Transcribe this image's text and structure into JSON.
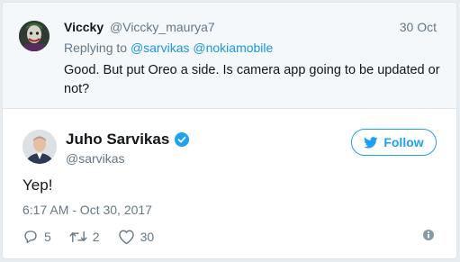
{
  "parent_tweet": {
    "name": "Viccky",
    "handle": "@Viccky_maurya7",
    "time": "30 Oct",
    "replying_prefix": "Replying to",
    "mentions": [
      "@sarvikas",
      "@nokiamobile"
    ],
    "text": "Good. But put Oreo a side. Is camera app going to be updated or not?"
  },
  "main_tweet": {
    "name": "Juho Sarvikas",
    "handle": "@sarvikas",
    "follow_label": "Follow",
    "text": "Yep!",
    "timestamp": "6:17 AM - Oct 30, 2017",
    "reply_count": "5",
    "retweet_count": "2",
    "like_count": "30"
  },
  "icons": {
    "verified": "verified-badge-icon",
    "follow": "twitter-bird-icon",
    "reply": "reply-icon",
    "retweet": "retweet-icon",
    "like": "heart-icon",
    "info": "info-icon"
  },
  "colors": {
    "accent": "#1da1f2",
    "mention": "#1b95e0",
    "muted": "#657786",
    "text": "#14171a",
    "parent_bg": "#f5f8fa"
  }
}
